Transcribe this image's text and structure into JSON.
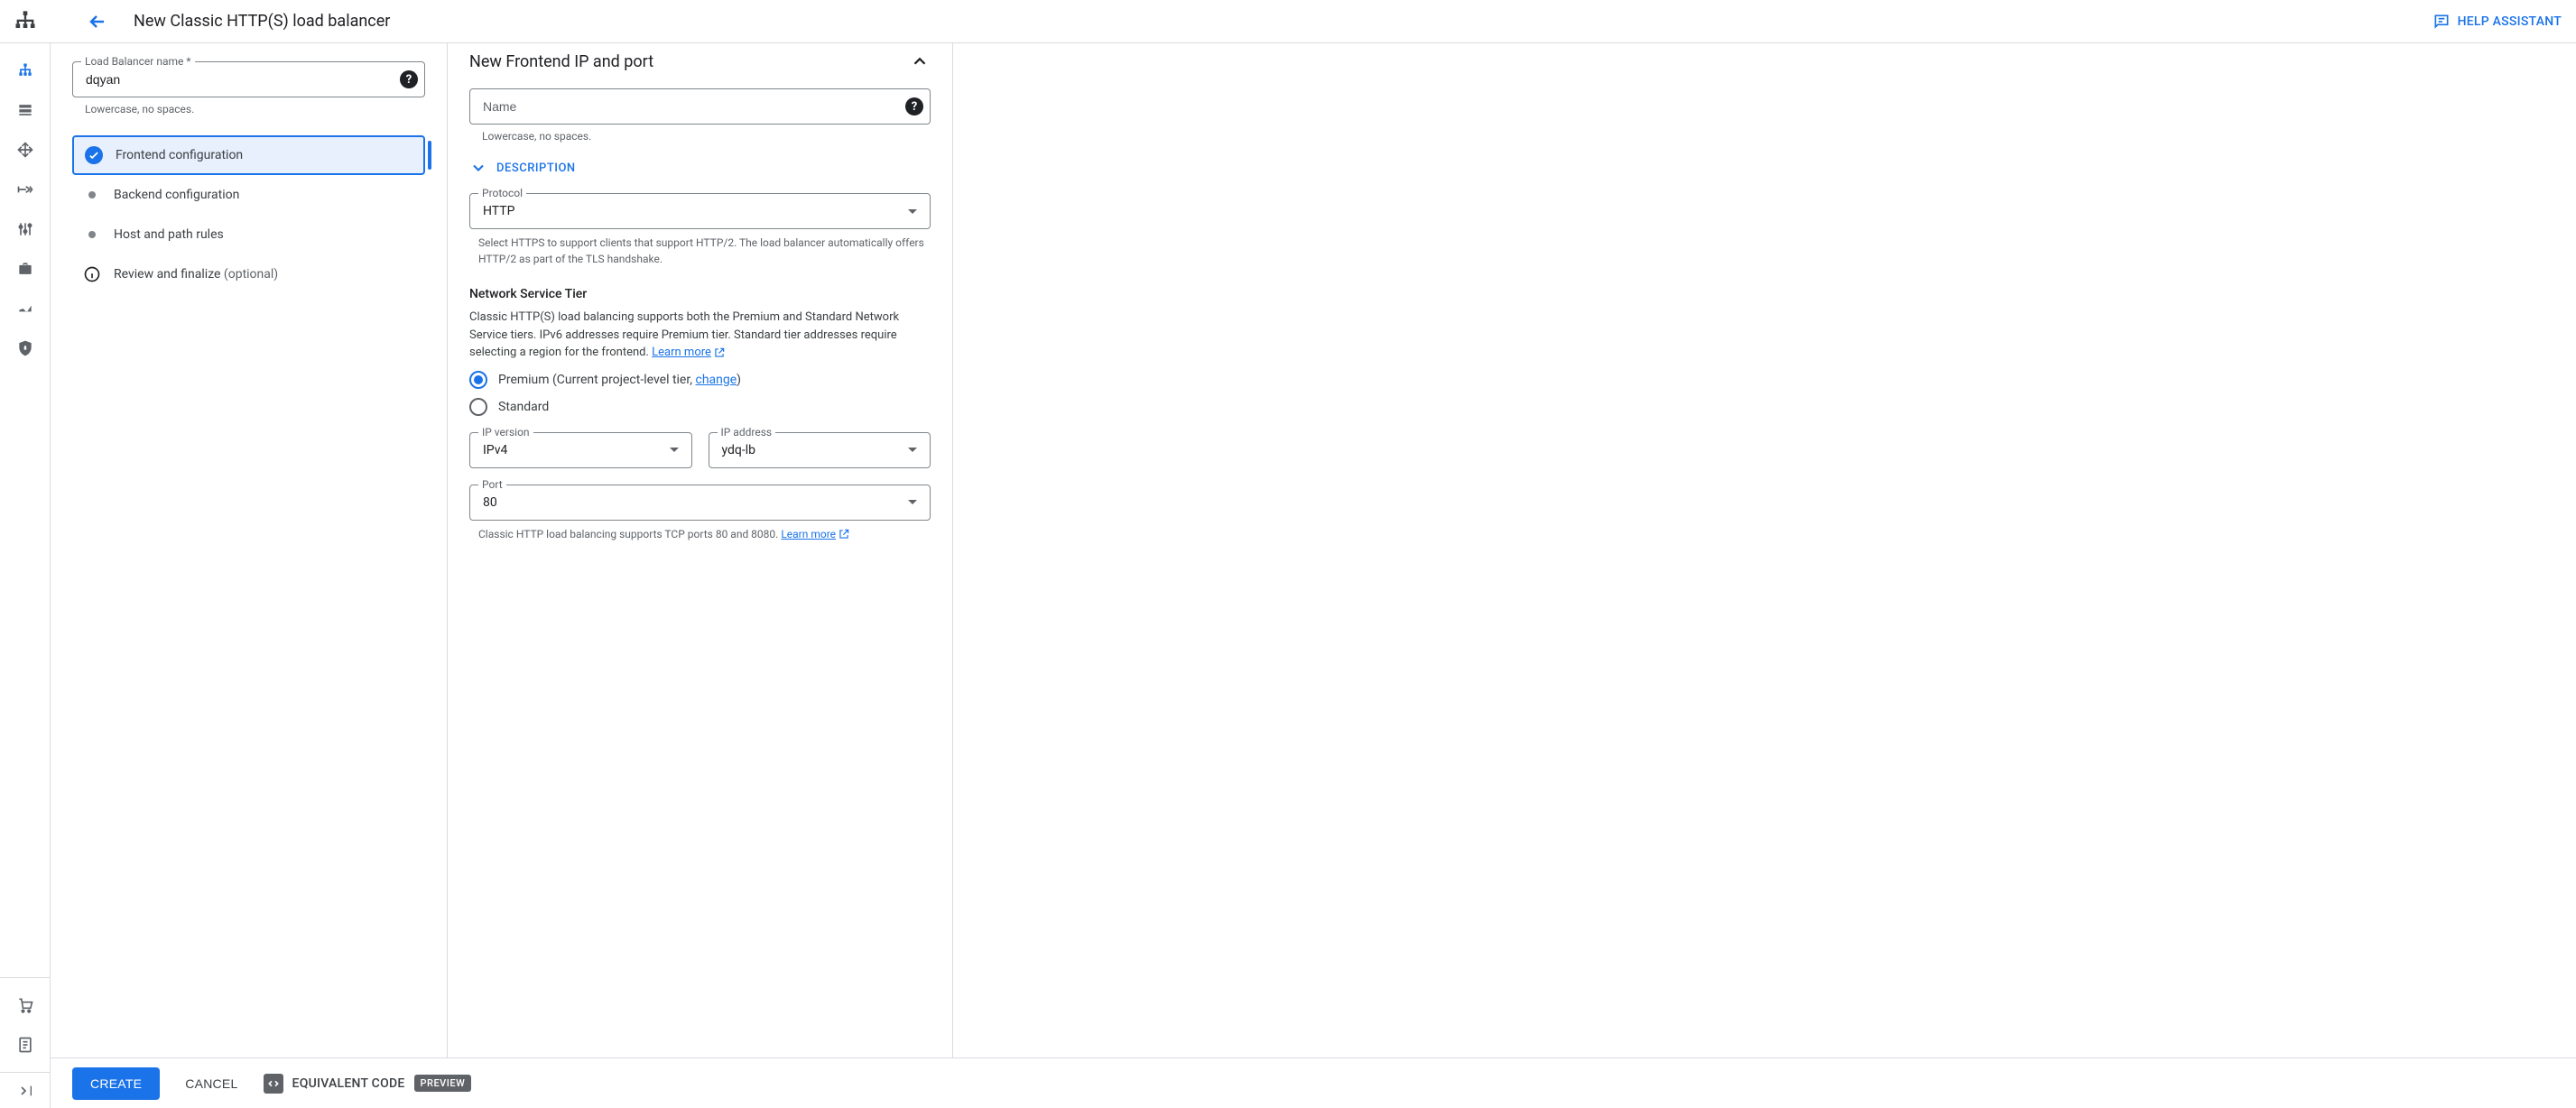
{
  "header": {
    "page_title": "New Classic HTTP(S) load balancer",
    "help_assistant": "HELP ASSISTANT"
  },
  "config": {
    "name_field": {
      "label": "Load Balancer name *",
      "value": "dqyan",
      "hint": "Lowercase, no spaces."
    },
    "steps": {
      "frontend": "Frontend configuration",
      "backend": "Backend configuration",
      "hostpath": "Host and path rules",
      "review": "Review and finalize",
      "review_optional": " (optional)"
    }
  },
  "detail": {
    "title": "New Frontend IP and port",
    "name_field": {
      "placeholder": "Name",
      "hint": "Lowercase, no spaces."
    },
    "description_toggle": "DESCRIPTION",
    "protocol": {
      "label": "Protocol",
      "value": "HTTP",
      "help": "Select HTTPS to support clients that support HTTP/2. The load balancer automatically offers HTTP/2 as part of the TLS handshake."
    },
    "tier": {
      "heading": "Network Service Tier",
      "body_prefix": " Classic HTTP(S) load balancing supports both the Premium and Standard Network Service tiers. IPv6 addresses require Premium tier. Standard tier addresses require selecting a region for the frontend. ",
      "learn_more": "Learn more",
      "premium_prefix": "Premium (Current project-level tier, ",
      "premium_change": "change",
      "premium_suffix": ")",
      "standard": "Standard"
    },
    "ip_version": {
      "label": "IP version",
      "value": "IPv4"
    },
    "ip_address": {
      "label": "IP address",
      "value": "ydq-lb"
    },
    "port": {
      "label": "Port",
      "value": "80",
      "help_prefix": "Classic HTTP load balancing supports TCP ports 80 and 8080. ",
      "learn_more": "Learn more"
    }
  },
  "footer": {
    "create": "CREATE",
    "cancel": "CANCEL",
    "equivalent_code": "EQUIVALENT CODE",
    "preview": "PREVIEW"
  }
}
